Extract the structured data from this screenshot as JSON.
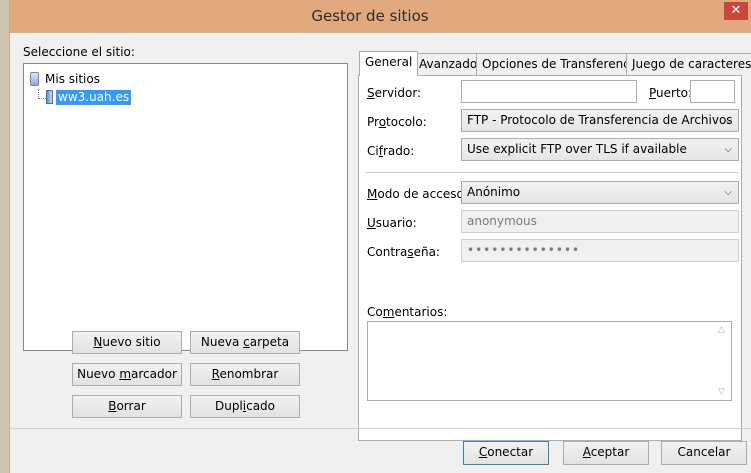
{
  "window": {
    "title": "Gestor de sitios",
    "close_glyph": "✕"
  },
  "sites": {
    "label": "Seleccione el sitio:",
    "root": "Mis sitios",
    "selected_site": "ww3.uah.es"
  },
  "left_buttons": {
    "new_site": {
      "pre": "",
      "u": "N",
      "post": "uevo sitio"
    },
    "new_folder": {
      "pre": "Nueva ",
      "u": "c",
      "post": "arpeta"
    },
    "new_bookmark": {
      "pre": "Nuevo ",
      "u": "m",
      "post": "arcador"
    },
    "rename": {
      "pre": "",
      "u": "R",
      "post": "enombrar"
    },
    "delete": {
      "pre": "",
      "u": "B",
      "post": "orrar"
    },
    "duplicate": {
      "pre": "Dupl",
      "u": "i",
      "post": "cado"
    }
  },
  "tabs": [
    {
      "label": "General"
    },
    {
      "label": "Avanzado"
    },
    {
      "label": "Opciones de Transferencia"
    },
    {
      "label": "Juego de caracteres"
    }
  ],
  "form": {
    "server_label": {
      "pre": "",
      "u": "S",
      "post": "ervidor:"
    },
    "server_value": "",
    "port_label": {
      "pre": "",
      "u": "P",
      "post": "uerto:"
    },
    "port_value": "",
    "protocol_label": {
      "pre": "Pr",
      "u": "o",
      "post": "tocolo:"
    },
    "protocol_value": "FTP - Protocolo de Transferencia de Archivos",
    "encryption_label": {
      "pre": "Ci",
      "u": "f",
      "post": "rado:"
    },
    "encryption_value": "Use explicit FTP over TLS if available",
    "access_mode_label": {
      "pre": "",
      "u": "M",
      "post": "odo de acceso:"
    },
    "access_mode_value": "Anónimo",
    "user_label": {
      "pre": "",
      "u": "U",
      "post": "suario:"
    },
    "user_value": "anonymous",
    "password_label": {
      "pre": "Contra",
      "u": "s",
      "post": "eña:"
    },
    "password_value": "••••••••••••••",
    "comments_label": {
      "pre": "Co",
      "u": "m",
      "post": "entarios:"
    },
    "comments_value": ""
  },
  "footer": {
    "connect": {
      "pre": "",
      "u": "C",
      "post": "onectar"
    },
    "accept": {
      "pre": "",
      "u": "A",
      "post": "ceptar"
    },
    "cancel": {
      "pre": "Cancelar",
      "u": "",
      "post": ""
    }
  },
  "icons": {
    "chevron": "chevron-down-icon",
    "root": "site-root-icon",
    "server": "server-icon"
  },
  "colors": {
    "titlebar": "#e3a97e",
    "close": "#c7473c",
    "selection": "#3399ff"
  }
}
